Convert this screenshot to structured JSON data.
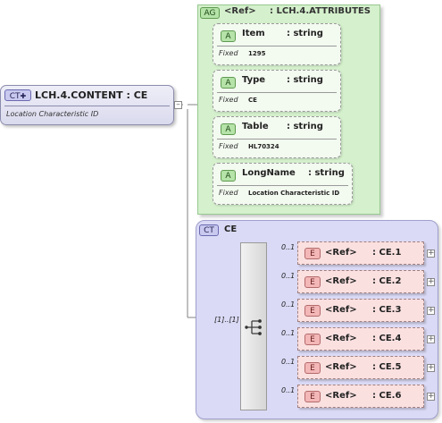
{
  "root": {
    "badge": "CT",
    "title": "LCH.4.CONTENT : CE",
    "documentation": "Location Characteristic ID"
  },
  "attribute_group": {
    "badge": "AG",
    "ref_label": "<Ref>",
    "name": ": LCH.4.ATTRIBUTES",
    "attributes": [
      {
        "badge": "A",
        "name": "Item",
        "type": ": string",
        "fixed_label": "Fixed",
        "fixed_value": "1295"
      },
      {
        "badge": "A",
        "name": "Type",
        "type": ": string",
        "fixed_label": "Fixed",
        "fixed_value": "CE"
      },
      {
        "badge": "A",
        "name": "Table",
        "type": ": string",
        "fixed_label": "Fixed",
        "fixed_value": "HL70324"
      },
      {
        "badge": "A",
        "name": "LongName",
        "type": ": string",
        "fixed_label": "Fixed",
        "fixed_value": "Location Characteristic ID"
      }
    ]
  },
  "complex_type": {
    "badge": "CT",
    "name": "CE",
    "sequence_occurrence": "[1]..[1]",
    "elements": [
      {
        "badge": "E",
        "ref": "<Ref>",
        "type": ": CE.1",
        "occurrence": "0..1"
      },
      {
        "badge": "E",
        "ref": "<Ref>",
        "type": ": CE.2",
        "occurrence": "0..1"
      },
      {
        "badge": "E",
        "ref": "<Ref>",
        "type": ": CE.3",
        "occurrence": "0..1"
      },
      {
        "badge": "E",
        "ref": "<Ref>",
        "type": ": CE.4",
        "occurrence": "0..1"
      },
      {
        "badge": "E",
        "ref": "<Ref>",
        "type": ": CE.5",
        "occurrence": "0..1"
      },
      {
        "badge": "E",
        "ref": "<Ref>",
        "type": ": CE.6",
        "occurrence": "0..1"
      }
    ]
  },
  "colors": {
    "complex_type_fill": "#dadaf6",
    "attribute_group_fill": "#d4f0cc",
    "element_fill": "#fbe0e0"
  },
  "icons": {
    "expand": "plus-icon",
    "collapse": "minus-icon",
    "sequence": "sequence-compositor-icon"
  }
}
